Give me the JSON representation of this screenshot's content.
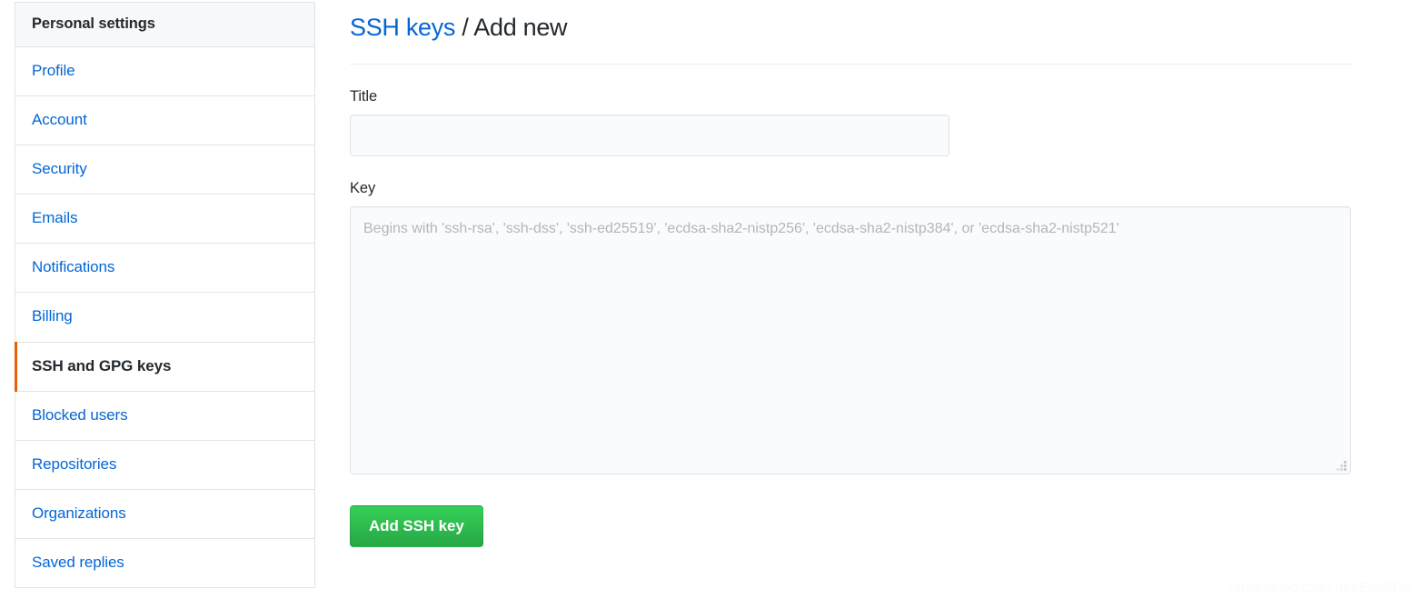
{
  "sidebar": {
    "header": "Personal settings",
    "items": [
      {
        "label": "Profile",
        "selected": false
      },
      {
        "label": "Account",
        "selected": false
      },
      {
        "label": "Security",
        "selected": false
      },
      {
        "label": "Emails",
        "selected": false
      },
      {
        "label": "Notifications",
        "selected": false
      },
      {
        "label": "Billing",
        "selected": false
      },
      {
        "label": "SSH and GPG keys",
        "selected": true
      },
      {
        "label": "Blocked users",
        "selected": false
      },
      {
        "label": "Repositories",
        "selected": false
      },
      {
        "label": "Organizations",
        "selected": false
      },
      {
        "label": "Saved replies",
        "selected": false
      }
    ],
    "accent_selected": "#e36209",
    "link_color": "#0366d6",
    "header_bg": "#f6f8fa"
  },
  "main": {
    "title_link": "SSH keys",
    "title_separator": " / ",
    "title_current": "Add new",
    "fields": {
      "title": {
        "label": "Title",
        "value": "",
        "placeholder": ""
      },
      "key": {
        "label": "Key",
        "value": "",
        "placeholder": "Begins with 'ssh-rsa', 'ssh-dss', 'ssh-ed25519', 'ecdsa-sha2-nistp256', 'ecdsa-sha2-nistp384', or 'ecdsa-sha2-nistp521'"
      }
    },
    "submit_label": "Add SSH key",
    "submit_color": "#28a745"
  },
  "watermark": {
    "text": "https://blog.csdn.net/EmilliFlo"
  }
}
